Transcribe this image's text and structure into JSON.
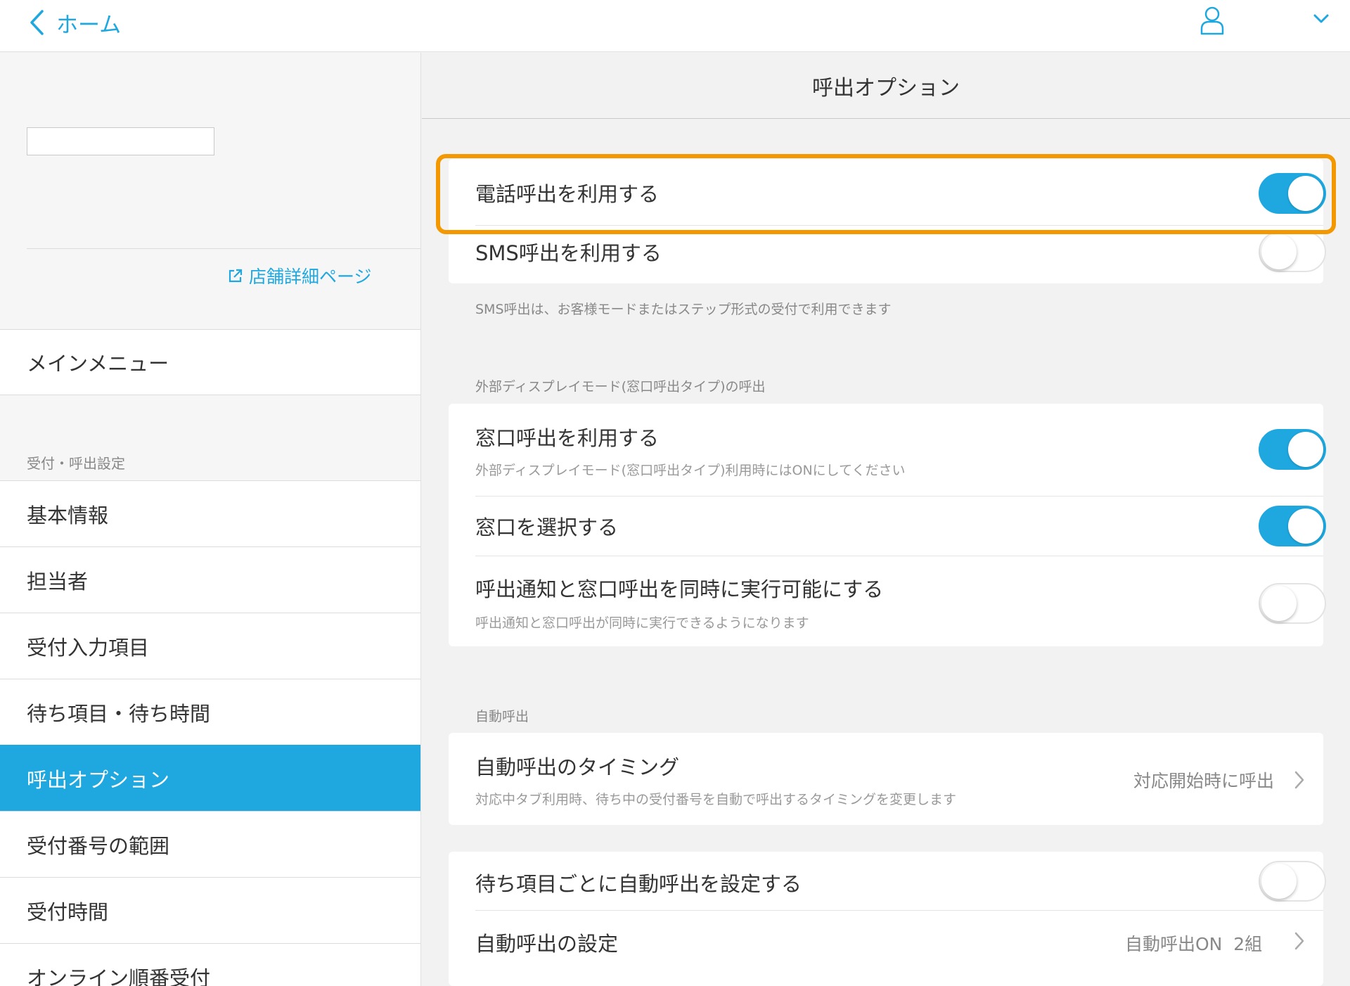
{
  "header": {
    "back_label": "ホーム"
  },
  "sidebar": {
    "store_detail_link": "店舗詳細ページ",
    "main_menu": "メインメニュー",
    "section_caption": "受付・呼出設定",
    "items": [
      {
        "label": "基本情報"
      },
      {
        "label": "担当者"
      },
      {
        "label": "受付入力項目"
      },
      {
        "label": "待ち項目・待ち時間"
      },
      {
        "label": "呼出オプション"
      },
      {
        "label": "受付番号の範囲"
      },
      {
        "label": "受付時間"
      },
      {
        "label": "オンライン順番受付"
      }
    ]
  },
  "main": {
    "title": "呼出オプション",
    "phone_call": {
      "label": "電話呼出を利用する",
      "on": true
    },
    "sms_call": {
      "label": "SMS呼出を利用する",
      "on": false
    },
    "sms_note": "SMS呼出は、お客様モードまたはステップ形式の受付で利用できます",
    "external_display_caption": "外部ディスプレイモード(窓口呼出タイプ)の呼出",
    "window_call": {
      "label": "窓口呼出を利用する",
      "sub": "外部ディスプレイモード(窓口呼出タイプ)利用時にはONにしてください",
      "on": true
    },
    "window_select": {
      "label": "窓口を選択する",
      "on": true
    },
    "simultaneous": {
      "label": "呼出通知と窓口呼出を同時に実行可能にする",
      "sub": "呼出通知と窓口呼出が同時に実行できるようになります",
      "on": false
    },
    "auto_call_caption": "自動呼出",
    "auto_timing": {
      "label": "自動呼出のタイミング",
      "sub": "対応中タブ利用時、待ち中の受付番号を自動で呼出するタイミングを変更します",
      "value": "対応開始時に呼出"
    },
    "per_item_auto": {
      "label": "待ち項目ごとに自動呼出を設定する",
      "on": false
    },
    "auto_settings": {
      "label": "自動呼出の設定",
      "value": "自動呼出ON  2組"
    }
  },
  "colors": {
    "accent": "#1ea8df",
    "highlight": "#f39800"
  }
}
